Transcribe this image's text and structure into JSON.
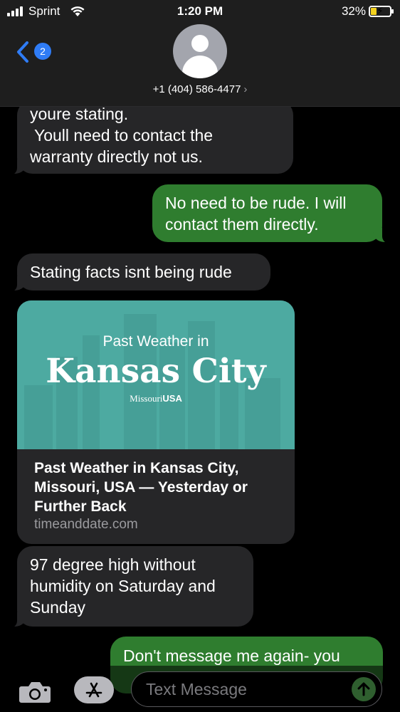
{
  "status_bar": {
    "carrier": "Sprint",
    "time": "1:20 PM",
    "battery_percent": "32%",
    "battery_level": 0.32,
    "battery_color": "#f4d21f",
    "icons": [
      "signal-bars-icon",
      "wifi-icon",
      "battery-charging-icon"
    ]
  },
  "header": {
    "back_badge_count": "2",
    "contact": "+1 (404) 586-4477",
    "chevron": "›",
    "accent": "#2f7cf6"
  },
  "messages": [
    {
      "direction": "incoming",
      "lines": [
        "youre stating.",
        " Youll need to contact the",
        "warranty directly not us."
      ]
    },
    {
      "direction": "outgoing",
      "lines": [
        "No need to be rude. I will",
        "contact them directly."
      ]
    },
    {
      "direction": "incoming",
      "lines": [
        "Stating facts isnt being rude"
      ]
    },
    {
      "direction": "incoming",
      "type": "link",
      "link": {
        "image_subtitle": "Past Weather in",
        "image_city": "Kansas City",
        "image_state": "Missouri",
        "image_country": "USA",
        "title_lines": [
          "Past Weather in Kansas City,",
          "Missouri, USA — Yesterday or",
          "Further Back"
        ],
        "domain": "timeanddate.com"
      }
    },
    {
      "direction": "incoming",
      "lines": [
        "97 degree high without",
        "humidity on Saturday and",
        "Sunday"
      ]
    },
    {
      "direction": "outgoing",
      "lines": [
        "Don't message me again- you"
      ]
    }
  ],
  "colors": {
    "incoming_bubble": "#262628",
    "outgoing_bubble": "#2f7d2f"
  },
  "input": {
    "placeholder": "Text Message",
    "camera_icon": "camera-icon",
    "apps_icon": "app-store-icon",
    "send_icon": "send-arrow-icon"
  }
}
